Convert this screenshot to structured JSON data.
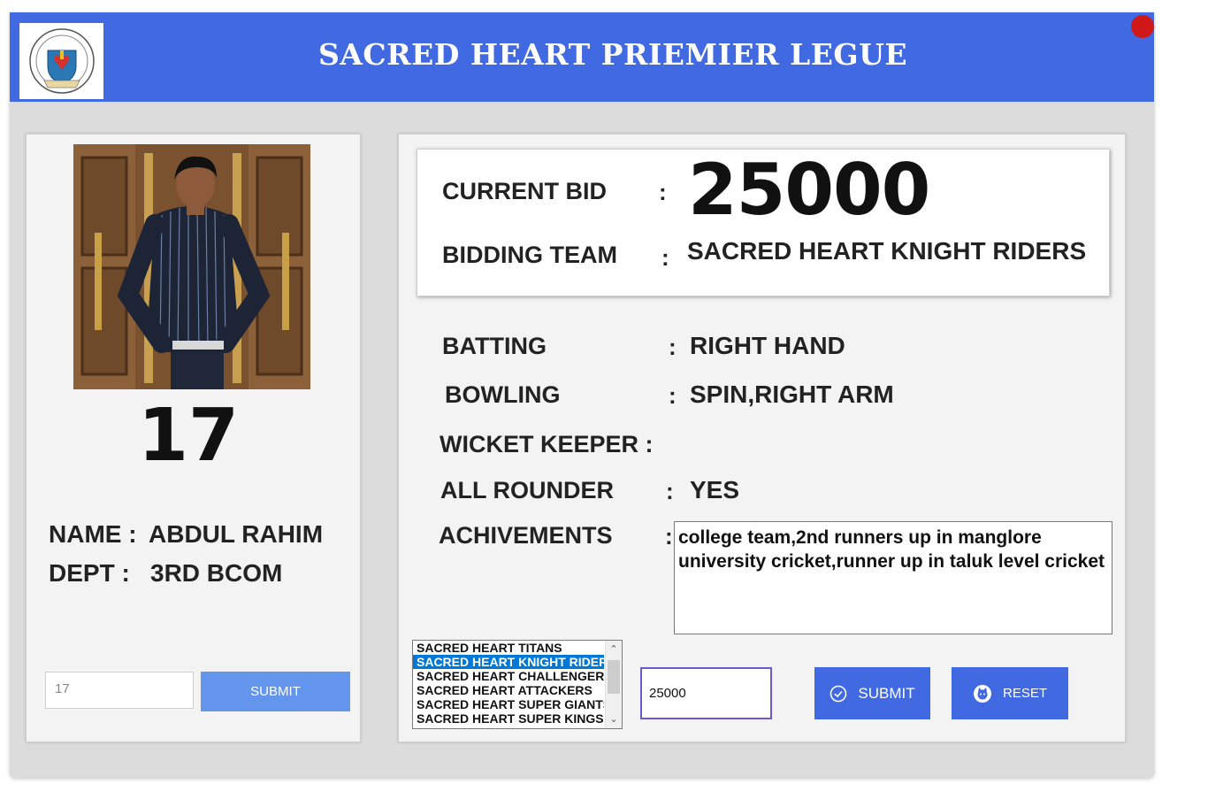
{
  "header": {
    "title": "SACRED HEART PRIEMIER LEGUE"
  },
  "logo": {
    "name": "college-logo-icon"
  },
  "player": {
    "number": "17",
    "name_label": "NAME :",
    "name": "ABDUL RAHIM",
    "dept_label": "DEPT  :",
    "dept": "3RD BCOM",
    "id_value": "17",
    "submit_label": "SUBMIT"
  },
  "bid": {
    "current_bid_label": "CURRENT BID",
    "current_bid": "25000",
    "bidding_team_label": "BIDDING TEAM",
    "bidding_team": "SACRED HEART KNIGHT RIDERS"
  },
  "stats": {
    "batting_label": "BATTING",
    "batting": "RIGHT HAND",
    "bowling_label": "BOWLING",
    "bowling": "SPIN,RIGHT ARM",
    "wicket_keeper_label": "WICKET KEEPER :",
    "wicket_keeper": "",
    "all_rounder_label": "ALL ROUNDER",
    "all_rounder": "YES",
    "achievements_label": "ACHIVEMENTS",
    "achievements": "college team,2nd runners up in manglore university cricket,runner up in taluk level cricket"
  },
  "teams": {
    "items": [
      "SACRED HEART TITANS",
      "SACRED HEART KNIGHT RIDERS",
      "SACRED HEART CHALLENGERS",
      "SACRED HEART ATTACKERS",
      "SACRED HEART SUPER GIANTS",
      "SACRED HEART SUPER KINGS"
    ],
    "selected_index": 1
  },
  "controls": {
    "bid_value": "25000",
    "submit_label": "SUBMIT",
    "reset_label": "RESET"
  },
  "colors": {
    "header": "#4169e1",
    "button": "#4169e1",
    "light_button": "#6495ed",
    "close": "#d01818"
  }
}
